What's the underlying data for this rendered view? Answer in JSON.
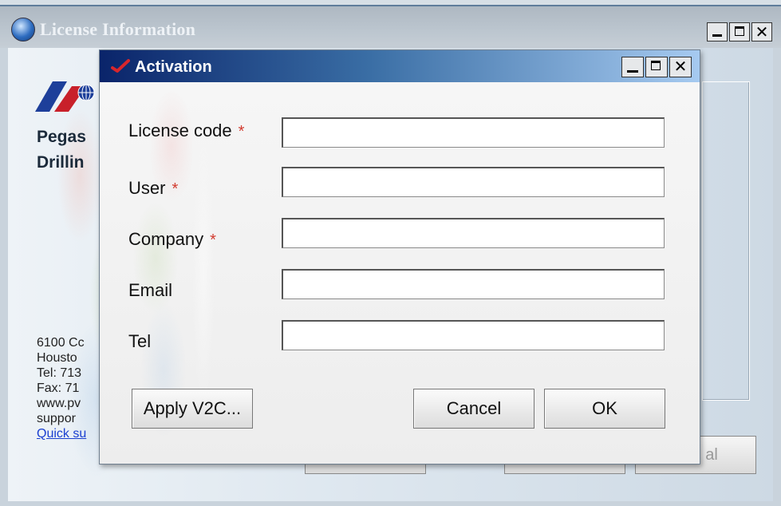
{
  "outer_window": {
    "title": "License Information",
    "company_line1": "Pegas",
    "company_line2": "Drillin",
    "address_lines": [
      "6100 Cc",
      "Housto",
      "Tel: 713",
      "Fax: 71",
      "www.pv",
      "suppor"
    ],
    "quick_support_link": "Quick su",
    "bg_button_label": "al"
  },
  "dialog": {
    "title": "Activation",
    "fields": [
      {
        "label": "License code",
        "required": true,
        "value": "",
        "required_mark": "*"
      },
      {
        "label": "User",
        "required": true,
        "value": "",
        "required_mark": "*"
      },
      {
        "label": "Company",
        "required": true,
        "value": "",
        "required_mark": "*"
      },
      {
        "label": "Email",
        "required": false,
        "value": ""
      },
      {
        "label": "Tel",
        "required": false,
        "value": ""
      }
    ],
    "buttons": {
      "apply": "Apply V2C...",
      "cancel": "Cancel",
      "ok": "OK"
    }
  },
  "icons": {
    "app": "app-globe-icon",
    "dialog": "check-icon",
    "min": "minimize-icon",
    "max": "maximize-icon",
    "close": "close-icon"
  },
  "colors": {
    "dialog_title_start": "#0a246a",
    "dialog_title_end": "#a6caf0",
    "required": "#d23a2e",
    "link": "#1a3fd0"
  }
}
